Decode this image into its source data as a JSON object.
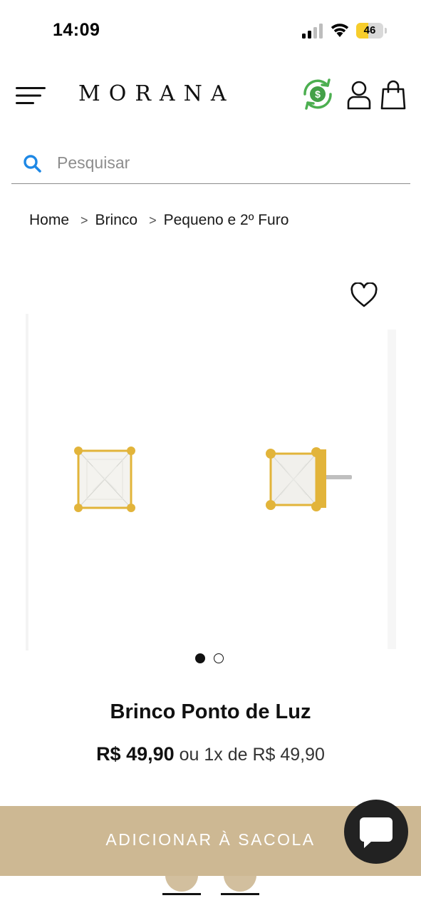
{
  "status_bar": {
    "time": "14:09",
    "battery_level": "46",
    "battery_fraction": 0.46,
    "battery_color": "#f7cd2c"
  },
  "header": {
    "logo": "MORANA",
    "icons": [
      "menu-icon",
      "cashback-icon",
      "user-icon",
      "bag-icon"
    ]
  },
  "search": {
    "placeholder": "Pesquisar",
    "value": "",
    "icon": "search-icon",
    "icon_color": "#1e88e5"
  },
  "breadcrumb": {
    "items": [
      "Home",
      "Brinco",
      "Pequeno e 2º Furo"
    ],
    "separator": ">"
  },
  "product": {
    "name": "Brinco Ponto de Luz",
    "price": "R$ 49,90",
    "installments": "ou 1x de R$ 49,90",
    "image_count": 2,
    "active_image": 0,
    "favorite_icon": "heart-icon"
  },
  "cta": {
    "add_to_bag_label": "ADICIONAR À SACOLA",
    "color": "#cdb893"
  },
  "chat": {
    "icon": "chat-icon",
    "color": "#222222"
  },
  "colors": {
    "cashback_green": "#4caf50",
    "gold": "#e2b43a"
  }
}
